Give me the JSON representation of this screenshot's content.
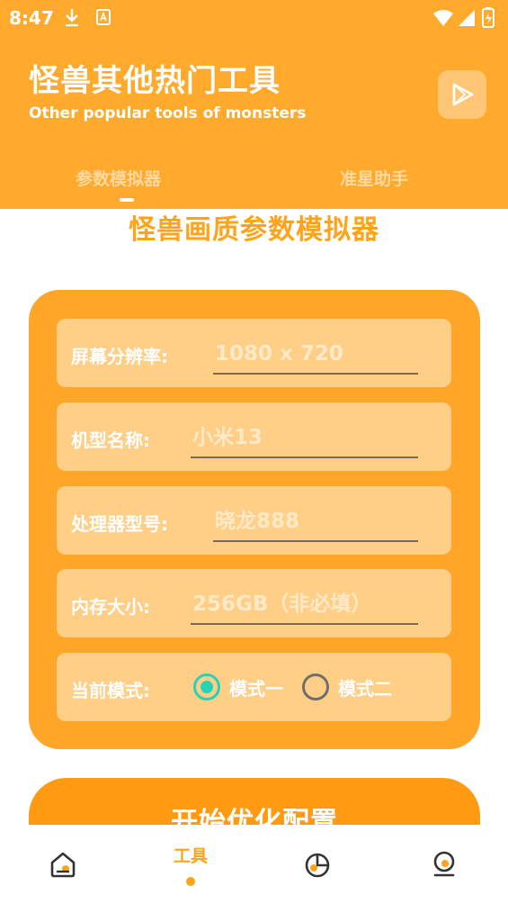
{
  "status_bar": {
    "time": "8:47"
  },
  "header": {
    "title": "怪兽其他热门工具",
    "subtitle": "Other popular tools of monsters"
  },
  "tabs": [
    {
      "label": "参数模拟器",
      "active": true
    },
    {
      "label": "准星助手",
      "active": false
    }
  ],
  "page_title": "怪兽画质参数模拟器",
  "form": {
    "resolution": {
      "label": "屏幕分辨率:",
      "placeholder": "1080 x 720",
      "value": ""
    },
    "model": {
      "label": "机型名称:",
      "placeholder": "小米13",
      "value": ""
    },
    "processor": {
      "label": "处理器型号:",
      "placeholder": "晓龙888",
      "value": ""
    },
    "memory": {
      "label": "内存大小:",
      "placeholder": "256GB（非必填）",
      "value": ""
    },
    "mode": {
      "label": "当前模式:",
      "options": [
        "模式一",
        "模式二"
      ],
      "selected": "模式一"
    }
  },
  "start_button": {
    "label": "开始优化配置"
  },
  "bottom_nav": [
    {
      "icon": "home-icon",
      "label": "",
      "active": false
    },
    {
      "icon": "",
      "label": "工具",
      "active": true
    },
    {
      "icon": "pie-chart-icon",
      "label": "",
      "active": false
    },
    {
      "icon": "profile-icon",
      "label": "",
      "active": false
    }
  ],
  "colors": {
    "header_bg": "#FFAA2C",
    "accent": "#FFA41A",
    "card_bg": "#FFA628",
    "row_bg": "#FFCE87",
    "radio_checked": "#27D2B5"
  }
}
